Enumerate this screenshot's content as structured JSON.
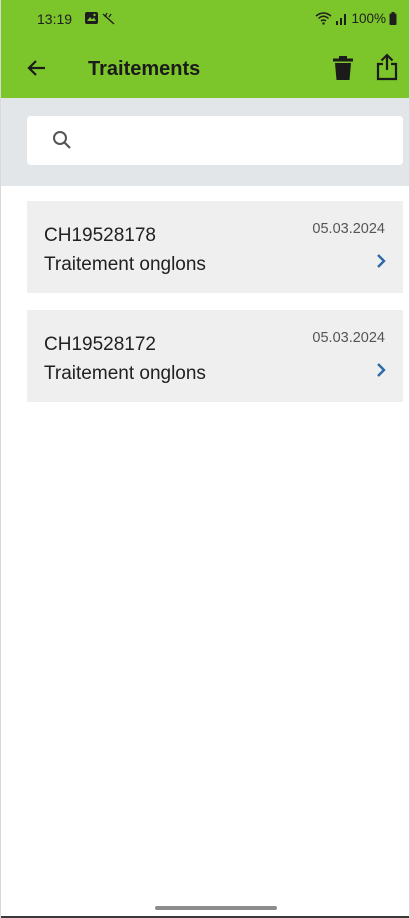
{
  "status_bar": {
    "time": "13:19",
    "battery": "100%",
    "icons": [
      "gallery-icon",
      "tools-icon",
      "wifi-icon",
      "signal-icon",
      "battery-icon"
    ]
  },
  "toolbar": {
    "title": "Traitements",
    "back_icon": "arrow-left-icon",
    "delete_icon": "trash-icon",
    "share_icon": "share-icon"
  },
  "search": {
    "placeholder": "",
    "value": "",
    "icon": "search-icon"
  },
  "items": [
    {
      "id": "CH19528178",
      "name": "Traitement onglons",
      "date": "05.03.2024"
    },
    {
      "id": "CH19528172",
      "name": "Traitement onglons",
      "date": "05.03.2024"
    }
  ],
  "colors": {
    "header_green": "#7cc52a",
    "search_bg": "#e3e6e8",
    "item_bg": "#efefef",
    "chevron_blue": "#2d6aa6"
  }
}
